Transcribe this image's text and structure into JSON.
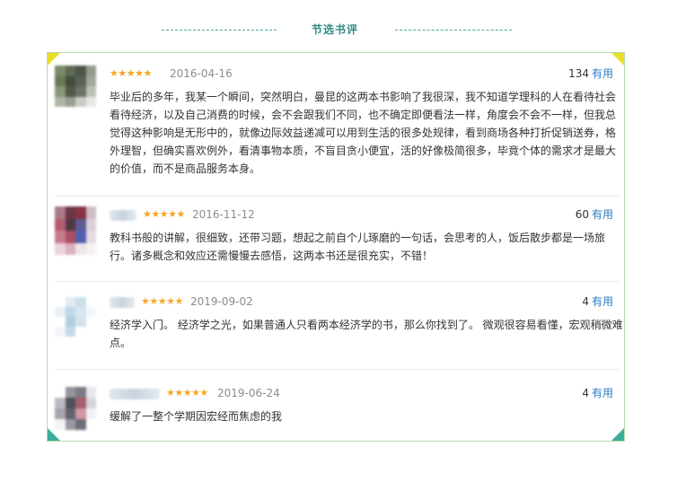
{
  "section": {
    "title": "节选书评"
  },
  "reviews": [
    {
      "stars": "★★★★★",
      "date": "2016-04-16",
      "useful_count": "134",
      "useful_label": "有用",
      "text": "毕业后的多年，我某一个瞬间，突然明白，曼昆的这两本书影响了我很深，我不知道学理科的人在看待社会看待经济，以及自己消费的时候，会不会跟我们不同，也不确定即便看法一样，角度会不会不一样，但我总觉得这种影响是无形中的，就像边际效益递减可以用到生活的很多处规律，看到商场各种打折促销送券，格外理智，但确实喜欢例外，看清事物本质，不盲目贪小便宜，活的好像极简很多，毕竟个体的需求才是最大的价值，而不是商品服务本身。"
    },
    {
      "stars": "★★★★★",
      "date": "2016-11-12",
      "useful_count": "60",
      "useful_label": "有用",
      "text": "教科书般的讲解，很细致，还带习题，想起之前自个儿琢磨的一句话，会思考的人，饭后散步都是一场旅行。诸多概念和效应还需慢慢去感悟，这两本书还是很充实，不错！"
    },
    {
      "stars": "★★★★★",
      "date": "2019-09-02",
      "useful_count": "4",
      "useful_label": "有用",
      "text": "经济学入门。 经济学之光，如果普通人只看两本经济学的书，那么你找到了。 微观很容易看懂，宏观稍微难点。"
    },
    {
      "stars": "★★★★★",
      "date": "2019-06-24",
      "useful_count": "4",
      "useful_label": "有用",
      "text": "缓解了一整个学期因宏经而焦虑的我"
    }
  ]
}
